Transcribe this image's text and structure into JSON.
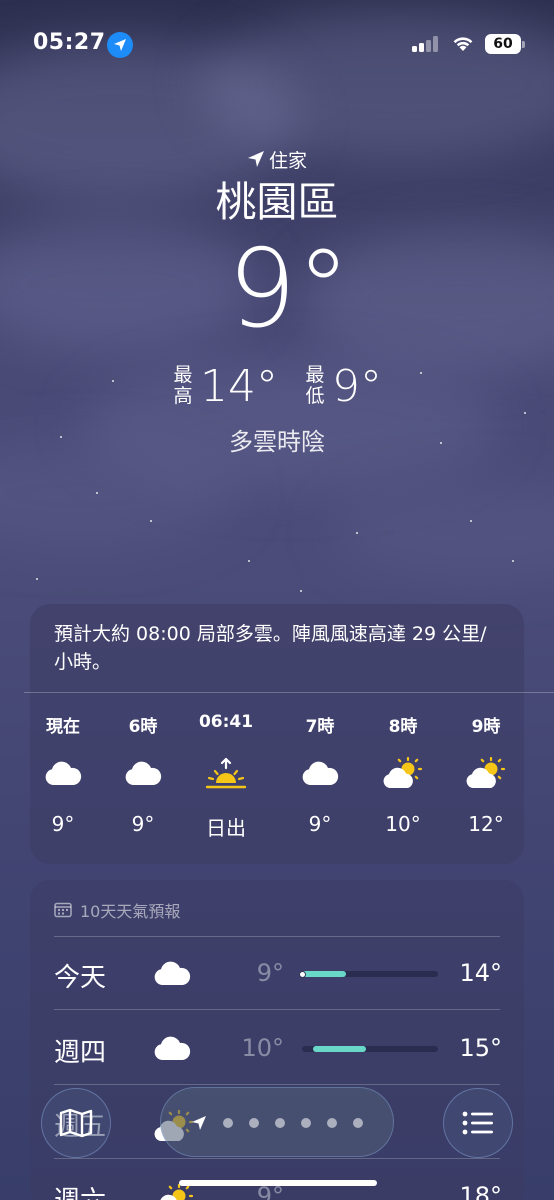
{
  "status_bar": {
    "time": "05:27",
    "battery": "60"
  },
  "location": {
    "home_label": "住家",
    "city": "桃園區",
    "current_temp": "9°",
    "high_label": "最高",
    "high": "14°",
    "low_label": "最低",
    "low": "9°",
    "condition": "多雲時陰"
  },
  "hourly": {
    "summary": "預計大約 08:00 局部多雲。陣風風速高達 29 公里/小時。",
    "hours": [
      {
        "label": "現在",
        "icon": "cloud-icon",
        "temp": "9°"
      },
      {
        "label": "6時",
        "icon": "cloud-icon",
        "temp": "9°"
      },
      {
        "label": "06:41",
        "icon": "sunrise-icon",
        "temp": "日出"
      },
      {
        "label": "7時",
        "icon": "cloud-icon",
        "temp": "9°"
      },
      {
        "label": "8時",
        "icon": "partly-sunny-icon",
        "temp": "10°"
      },
      {
        "label": "9時",
        "icon": "partly-sunny-icon",
        "temp": "12°"
      }
    ]
  },
  "daily": {
    "header": "10天天氣預報",
    "days": [
      {
        "name": "今天",
        "icon": "cloud-icon",
        "low": "9°",
        "high": "14°",
        "range_start": 0.0,
        "range_end": 0.32,
        "current": 0.0
      },
      {
        "name": "週四",
        "icon": "cloud-icon",
        "low": "10°",
        "high": "15°",
        "range_start": 0.08,
        "range_end": 0.47
      },
      {
        "name": "週五",
        "icon": "partly-sunny-icon",
        "low": "",
        "high": ""
      },
      {
        "name": "週六",
        "icon": "partly-sunny-icon",
        "low": "9°",
        "high": "18°"
      }
    ]
  },
  "bottom_bar": {
    "map_icon": "map-icon",
    "list_icon": "list-icon",
    "page_count": 6
  },
  "colors": {
    "accent_bar": "#6ad8c8",
    "location_pill": "#1d8cf8",
    "sun": "#f5c518"
  }
}
